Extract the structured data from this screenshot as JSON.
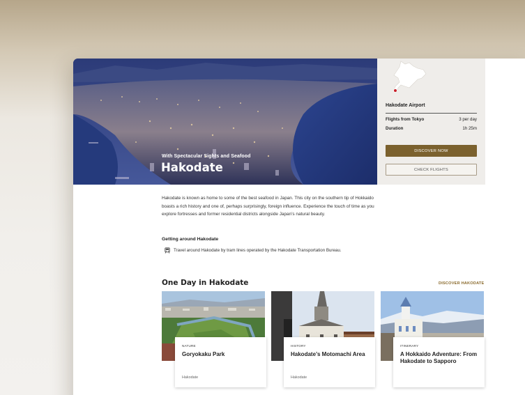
{
  "hero": {
    "subtitle": "With Spectacular Sights and Seafood",
    "title": "Hakodate"
  },
  "sidebar": {
    "airport": "Hakodate Airport",
    "rows": [
      {
        "label": "Flights from Tokyo",
        "value": "3 per day"
      },
      {
        "label": "Duration",
        "value": "1h 25m"
      }
    ],
    "discover_button": "DISCOVER NOW",
    "check_button": "CHECK FLIGHTS"
  },
  "intro": "Hakodate is known as home to some of the best seafood in Japan. This city on the southern tip of Hokkaido boasts a rich history and one of, perhaps surprisingly, foreign influence. Experience the touch of time as you explore fortresses and former residential districts alongside Japan’s natural beauty.",
  "getting_around": {
    "heading": "Getting around Hakodate",
    "text": "Travel around Hakodate by tram lines operated by the Hakodate Transportation Bureau.",
    "icon": "tram-icon"
  },
  "section": {
    "title": "One Day in Hakodate",
    "link": "DISCOVER HAKODATE"
  },
  "cards": [
    {
      "category": "NATURE",
      "title": "Goryokaku Park",
      "location": "Hakodate"
    },
    {
      "category": "HISTORY",
      "title": "Hakodate’s Motomachi Area",
      "location": "Hakodate"
    },
    {
      "category": "ITINERARY",
      "title": "A Hokkaido Adventure: From Hakodate to Sapporo",
      "location": ""
    }
  ],
  "colors": {
    "accent": "#7b612e",
    "link": "#8a6a2c",
    "map_marker": "#c8202a"
  }
}
